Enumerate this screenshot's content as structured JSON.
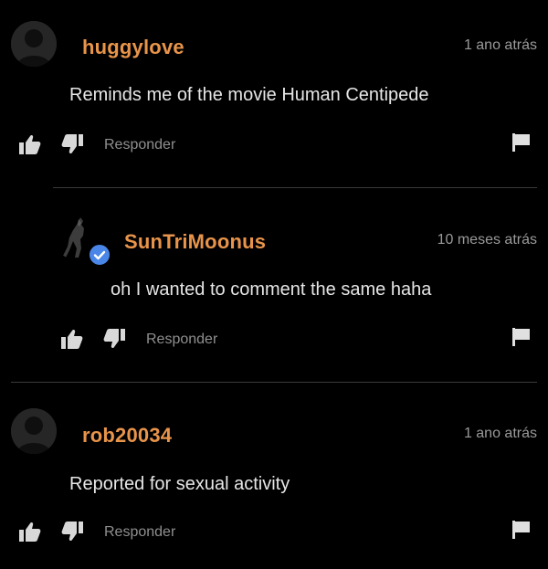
{
  "comments": [
    {
      "username": "huggylove",
      "timestamp": "1 ano atrás",
      "text": "Reminds me of the movie Human Centipede",
      "reply_label": "Responder",
      "avatar": "default-avatar"
    },
    {
      "username": "SunTriMoonus",
      "timestamp": "10 meses atrás",
      "text": "oh I wanted to comment the same haha",
      "reply_label": "Responder",
      "avatar": "figure-avatar",
      "verified": true
    },
    {
      "username": "rob20034",
      "timestamp": "1 ano atrás",
      "text": "Reported for sexual activity",
      "reply_label": "Responder",
      "avatar": "default-avatar"
    }
  ],
  "colors": {
    "background": "#000000",
    "username": "#e8944a",
    "text": "#e6e6e6",
    "muted": "#9a9a9a",
    "divider": "#3a3a3a",
    "verified_badge": "#4a86e8"
  },
  "icons": [
    "thumbs-up-icon",
    "thumbs-down-icon",
    "flag-icon",
    "verified-check-icon",
    "avatar-icon"
  ]
}
